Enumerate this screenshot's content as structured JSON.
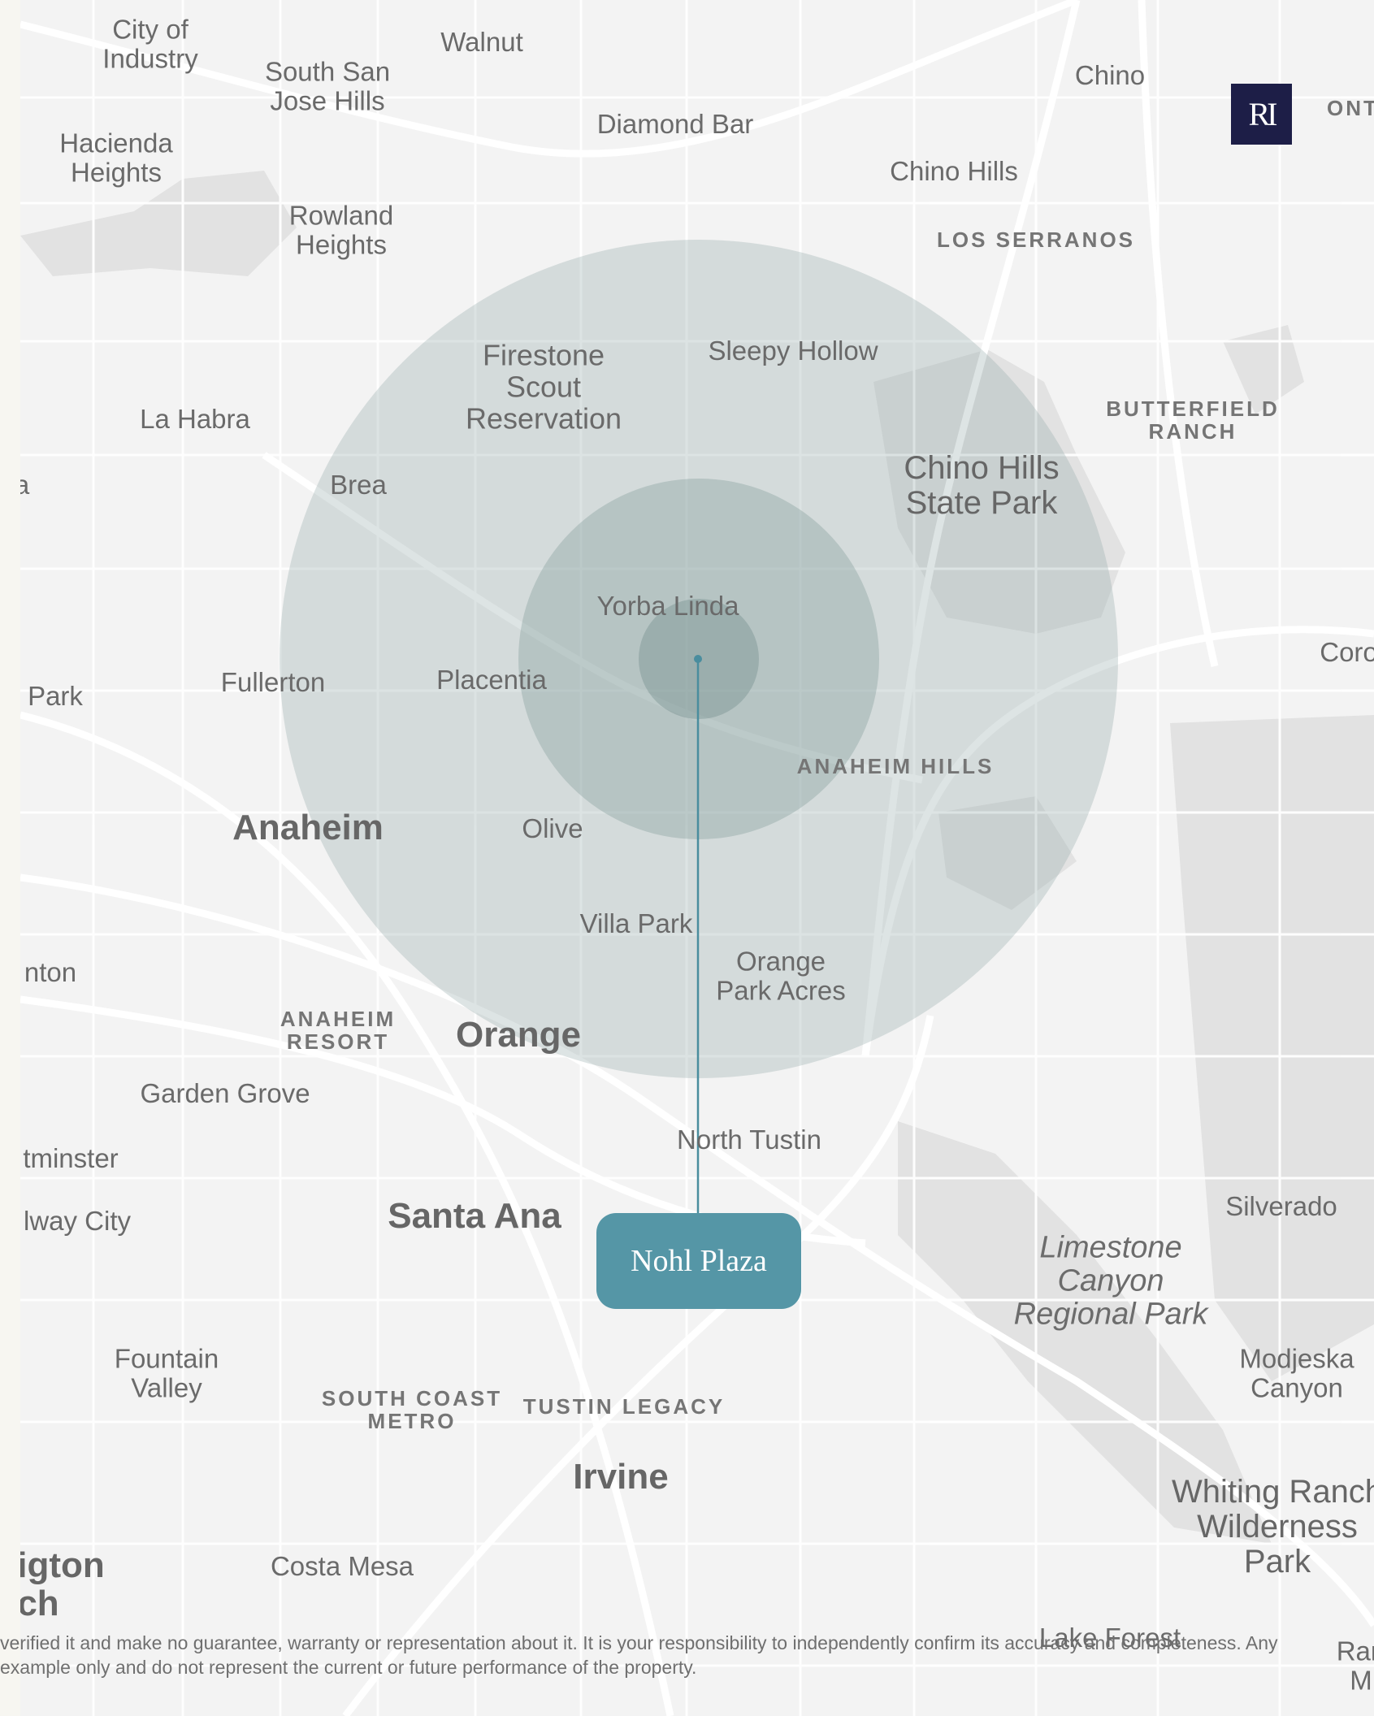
{
  "brand": {
    "logo_text": "RI",
    "logo_color": "#1d1e47"
  },
  "callout": {
    "label": "Nohl Plaza",
    "color": "#5596a6"
  },
  "rings": {
    "count": 3,
    "fill": "#8fa7a5"
  },
  "places": {
    "city_of_industry": "City of\nIndustry",
    "walnut": "Walnut",
    "south_san_jose_hills": "South San\nJose Hills",
    "chino": "Chino",
    "ont": "ONT",
    "diamond_bar": "Diamond Bar",
    "hacienda_heights": "Hacienda\nHeights",
    "chino_hills": "Chino Hills",
    "rowland_heights": "Rowland\nHeights",
    "los_serranos": "LOS SERRANOS",
    "firestone": "Firestone\nScout\nReservation",
    "sleepy_hollow": "Sleepy Hollow",
    "la_habra": "La Habra",
    "butterfield_ranch": "BUTTERFIELD\nRANCH",
    "a_partial": "a",
    "brea": "Brea",
    "chino_hills_state_park": "Chino Hills\nState Park",
    "yorba_linda": "Yorba Linda",
    "coro_partial": "Coro",
    "park_partial": "Park",
    "fullerton": "Fullerton",
    "placentia": "Placentia",
    "anaheim_hills": "ANAHEIM HILLS",
    "anaheim": "Anaheim",
    "olive": "Olive",
    "villa_park": "Villa Park",
    "orange_park_acres": "Orange\nPark Acres",
    "nton_partial": "nton",
    "anaheim_resort": "ANAHEIM\nRESORT",
    "orange": "Orange",
    "garden_grove": "Garden Grove",
    "north_tustin": "North Tustin",
    "tminster_partial": "tminster",
    "silverado": "Silverado",
    "lway_city_partial": "lway City",
    "santa_ana": "Santa Ana",
    "limestone_canyon": "Limestone\nCanyon\nRegional Park",
    "fountain_valley": "Fountain\nValley",
    "modjeska_canyon": "Modjeska\nCanyon",
    "south_coast_metro": "SOUTH COAST\nMETRO",
    "tustin_legacy": "TUSTIN LEGACY",
    "irvine": "Irvine",
    "whiting_ranch": "Whiting Ranch\nWilderness\nPark",
    "igton_partial": "igton",
    "costa_mesa": "Costa Mesa",
    "ch_partial": "ch",
    "lake_forest": "Lake Forest",
    "ran_partial": "Ran\nM"
  },
  "disclaimer": {
    "line1": "verified it and make no guarantee, warranty or representation about it. It is your responsibility to independently confirm its accuracy and completeness. Any",
    "line2": "example only and do not represent the current or future performance of the property."
  }
}
